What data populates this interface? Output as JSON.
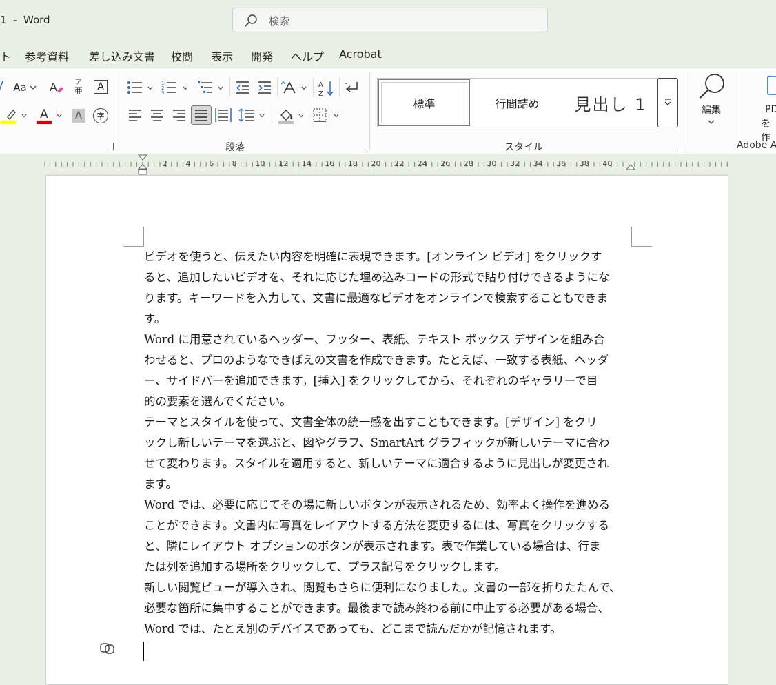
{
  "window": {
    "title": "1  -  Word"
  },
  "search": {
    "placeholder": "検索"
  },
  "menu": {
    "tabs": [
      "ト",
      "参考資料",
      "差し込み文書",
      "校閲",
      "表示",
      "開発",
      "ヘルプ",
      "Acrobat"
    ]
  },
  "ribbon": {
    "font": {
      "change_case_label": "Aa",
      "phonetic_top": "ア",
      "phonetic_bottom": "亜",
      "char_border_label": "A",
      "font_color_label": "A",
      "char_shading_label": "A",
      "enclose_label": "字",
      "highlight_color": "#ffff00",
      "font_color": "#e00000"
    },
    "paragraph": {
      "group_label": "段落"
    },
    "styles": {
      "group_label": "スタイル",
      "items": [
        "標準",
        "行間詰め",
        "見出し 1"
      ]
    },
    "editing": {
      "label": "編集"
    },
    "adobe": {
      "label_line1": "PD",
      "label_line2": "を作",
      "group_label": "Adobe A"
    }
  },
  "ruler": {
    "numbers": [
      "2",
      "4",
      "6",
      "8",
      "10",
      "12",
      "14",
      "16",
      "18",
      "20",
      "22",
      "24",
      "26",
      "28",
      "30",
      "32",
      "34",
      "36",
      "38",
      "40"
    ]
  },
  "document": {
    "lines": [
      "ビデオを使うと、伝えたい内容を明確に表現できます。[オンライン ビデオ] をクリックす",
      "ると、追加したいビデオを、それに応じた埋め込みコードの形式で貼り付けできるようにな",
      "ります。キーワードを入力して、文書に最適なビデオをオンラインで検索することもできま",
      "す。",
      "Word に用意されているヘッダー、フッター、表紙、テキスト ボックス デザインを組み合",
      "わせると、プロのようなできばえの文書を作成できます。たとえば、一致する表紙、ヘッダ",
      "ー、サイドバーを追加できます。[挿入] をクリックしてから、それぞれのギャラリーで目",
      "的の要素を選んでください。",
      "テーマとスタイルを使って、文書全体の統一感を出すこともできます。[デザイン] をクリ",
      "ックし新しいテーマを選ぶと、図やグラフ、SmartArt グラフィックが新しいテーマに合わ",
      "せて変わります。スタイルを適用すると、新しいテーマに適合するように見出しが変更され",
      "ます。",
      "Word では、必要に応じてその場に新しいボタンが表示されるため、効率よく操作を進める",
      "ことができます。文書内に写真をレイアウトする方法を変更するには、写真をクリックする",
      "と、隣にレイアウト オプションのボタンが表示されます。表で作業している場合は、行ま",
      "たは列を追加する場所をクリックして、プラス記号をクリックします。",
      "新しい閲覧ビューが導入され、閲覧もさらに便利になりました。文書の一部を折りたたんで、",
      "必要な箇所に集中することができます。最後まで読み終わる前に中止する必要がある場合、",
      "Word では、たとえ別のデバイスであっても、どこまで読んだかが記憶されます。"
    ]
  }
}
